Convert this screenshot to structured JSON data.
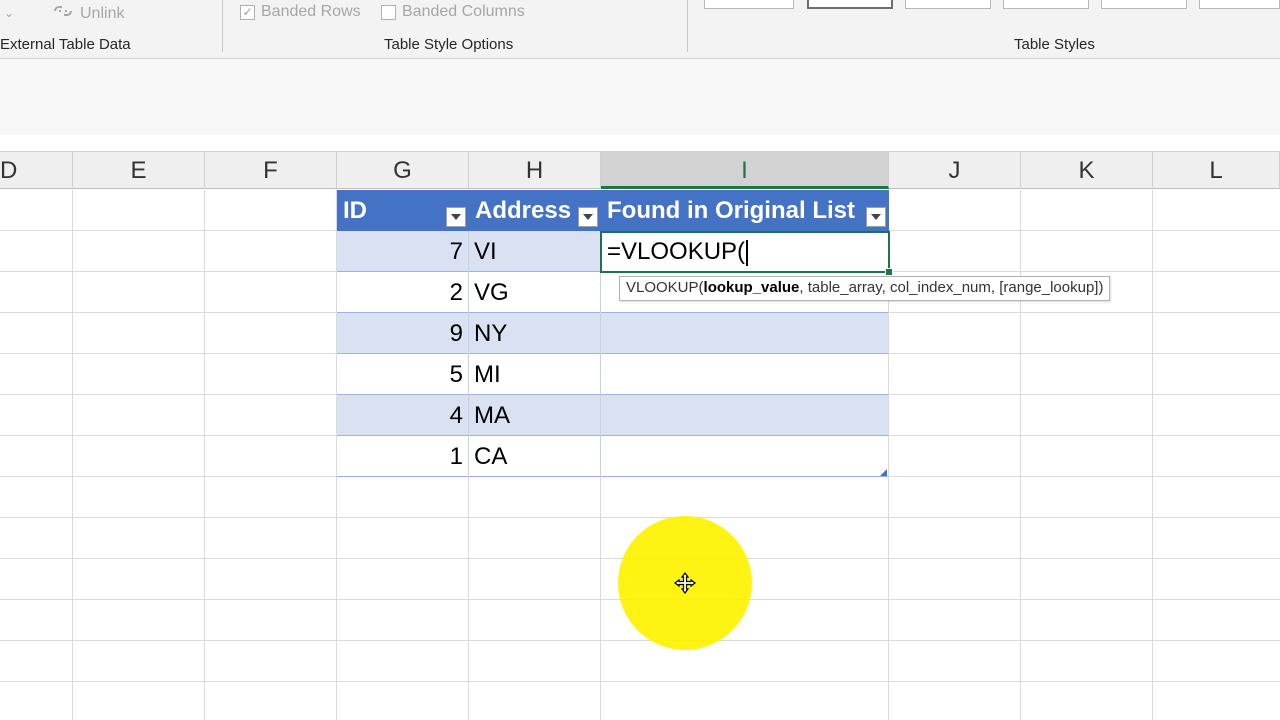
{
  "ribbon": {
    "unlink_label": "Unlink",
    "banded_rows_label": "Banded Rows",
    "banded_columns_label": "Banded Columns",
    "groups": {
      "external_table_data": "External Table Data",
      "table_style_options": "Table Style Options",
      "table_styles": "Table Styles"
    },
    "banded_rows_checked": true,
    "banded_columns_checked": false
  },
  "columns": [
    "D",
    "E",
    "F",
    "G",
    "H",
    "I",
    "J",
    "K",
    "L"
  ],
  "active_column": "I",
  "table": {
    "headers": [
      "ID",
      "Address",
      "Found in Original List"
    ],
    "rows": [
      {
        "id": "7",
        "address": "VI"
      },
      {
        "id": "2",
        "address": "VG"
      },
      {
        "id": "9",
        "address": "NY"
      },
      {
        "id": "5",
        "address": "MI"
      },
      {
        "id": "4",
        "address": "MA"
      },
      {
        "id": "1",
        "address": "CA"
      }
    ]
  },
  "active_cell": {
    "formula": "=VLOOKUP("
  },
  "tooltip": {
    "fn": "VLOOKUP(",
    "arg1": "lookup_value",
    "rest": ", table_array, col_index_num, [range_lookup])"
  },
  "colors": {
    "table_header": "#4472c4",
    "band": "#d9e1f2",
    "selection": "#217346",
    "highlight": "#fff200"
  }
}
